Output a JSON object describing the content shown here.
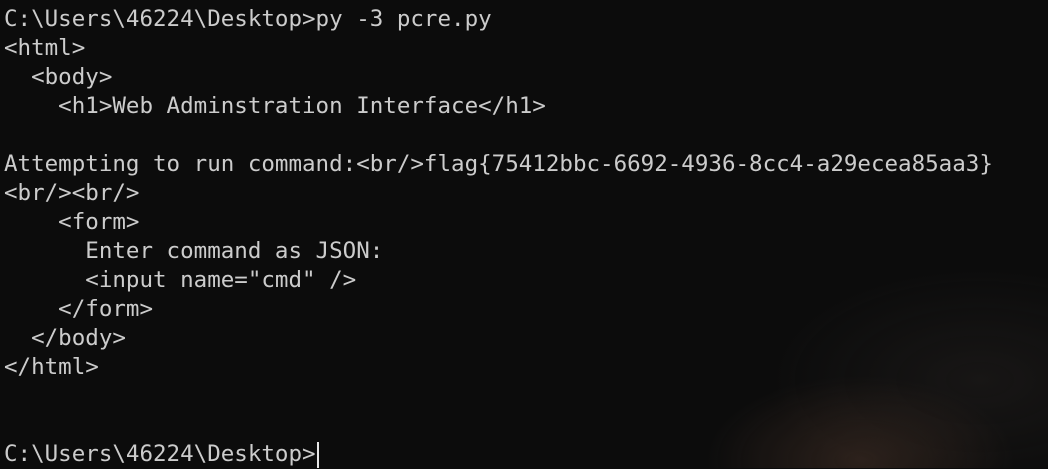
{
  "terminal": {
    "lines": [
      "C:\\Users\\46224\\Desktop>py -3 pcre.py",
      "<html>",
      "  <body>",
      "    <h1>Web Adminstration Interface</h1>",
      "",
      "Attempting to run command:<br/>flag{75412bbc-6692-4936-8cc4-a29ecea85aa3}",
      "<br/><br/>",
      "    <form>",
      "      Enter command as JSON:",
      "      <input name=\"cmd\" />",
      "    </form>",
      "  </body>",
      "</html>",
      "",
      "",
      "C:\\Users\\46224\\Desktop>"
    ]
  }
}
